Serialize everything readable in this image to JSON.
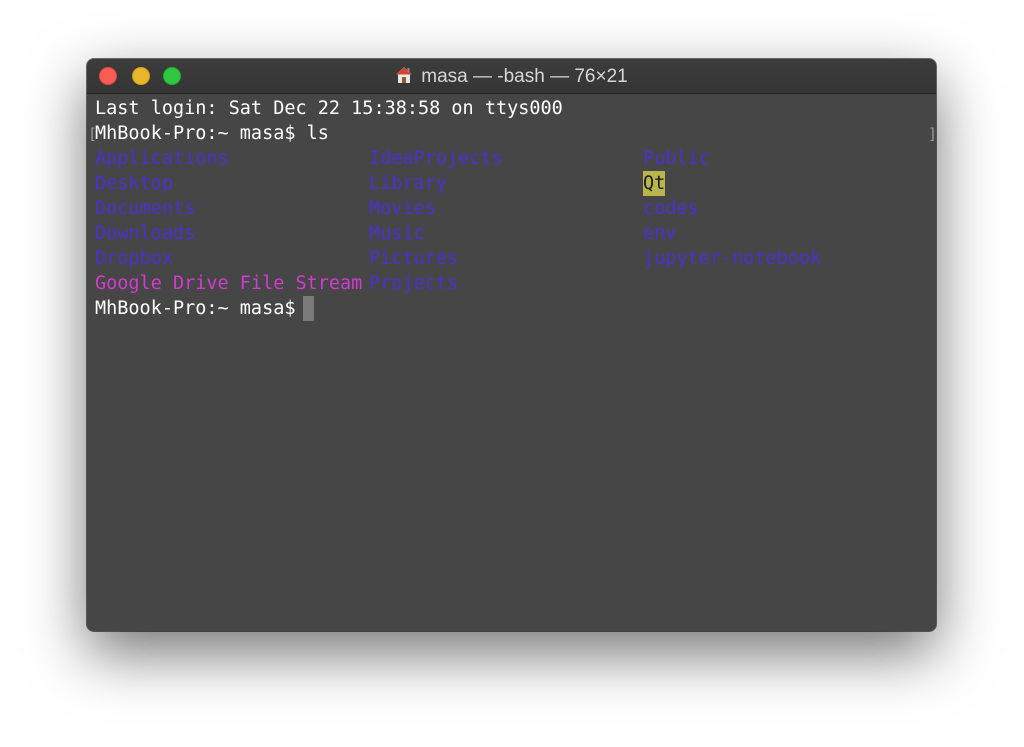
{
  "window": {
    "title": "masa — -bash — 76×21",
    "title_icon": "home-icon"
  },
  "terminal": {
    "last_login": "Last login: Sat Dec 22 15:38:58 on ttys000",
    "prompt_ls": "MhBook-Pro:~ masa$ ls",
    "prompt_current": "MhBook-Pro:~ masa$ ",
    "bracket_left": "[",
    "bracket_right": "]",
    "ls_columns": [
      [
        "Applications",
        "Desktop",
        "Documents",
        "Downloads",
        "Dropbox",
        "Google Drive File Stream"
      ],
      [
        "IdeaProjects",
        "Library",
        "Movies",
        "Music",
        "Pictures",
        "Projects"
      ],
      [
        "Public",
        "Qt",
        "codes",
        "env",
        "jupyter-notebook"
      ]
    ]
  },
  "colors": {
    "directory": "#4b2fd0",
    "symlink": "#d33ad2",
    "highlight_bg": "#b9b54c",
    "background": "#464646"
  }
}
